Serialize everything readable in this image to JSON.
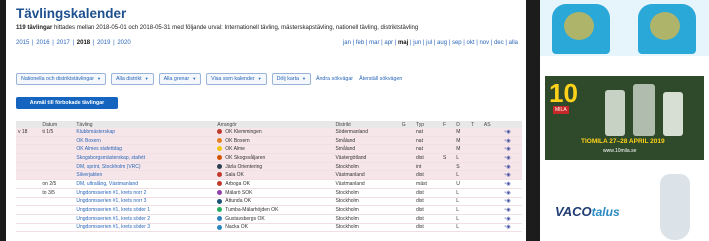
{
  "page": {
    "title": "Tävlingskalender",
    "summary_count": "119 tävlingar",
    "summary_text": " hittades mellan 2018-05-01 och 2018-05-31 med följande urval: Internationell tävling, mästerskapstävling, nationell tävling, distriktstävling",
    "years": [
      {
        "label": "2015",
        "selected": false
      },
      {
        "label": "2016",
        "selected": false
      },
      {
        "label": "2017",
        "selected": false
      },
      {
        "label": "2018",
        "selected": true
      },
      {
        "label": "2019",
        "selected": false
      },
      {
        "label": "2020",
        "selected": false
      }
    ],
    "months": [
      {
        "label": "jan",
        "selected": false
      },
      {
        "label": "feb",
        "selected": false
      },
      {
        "label": "mar",
        "selected": false
      },
      {
        "label": "apr",
        "selected": false
      },
      {
        "label": "maj",
        "selected": true
      },
      {
        "label": "jun",
        "selected": false
      },
      {
        "label": "jul",
        "selected": false
      },
      {
        "label": "aug",
        "selected": false
      },
      {
        "label": "sep",
        "selected": false
      },
      {
        "label": "okt",
        "selected": false
      },
      {
        "label": "nov",
        "selected": false
      },
      {
        "label": "dec",
        "selected": false
      },
      {
        "label": "alla",
        "selected": false
      }
    ],
    "filters": {
      "buttons": [
        "Nationella och distriktstävlingar",
        "Alla distrikt",
        "Alla grenar",
        "Visa som kalender",
        "Dölj karta"
      ],
      "links": [
        "Ändra sökvägar",
        "Återställ sökvägen"
      ]
    },
    "send_button": "Anmäl till förbokade tävlingar",
    "table": {
      "headers": [
        "",
        "Datum",
        "Tävling",
        "Arrangör",
        "Distrikt",
        "G",
        "Typ",
        "F",
        "D",
        "T",
        "AS",
        ""
      ],
      "rows": [
        {
          "week": "v 18",
          "date": "ti 1/5",
          "name": "Klubbmästerskap",
          "organizer": "OK Klemmingen",
          "org_color": "#c0392b",
          "district": "Södermanland",
          "type": "nat",
          "f": "",
          "d": "M",
          "style": "pink"
        },
        {
          "week": "",
          "date": "",
          "name": "OK Boxern",
          "organizer": "OK Boxern",
          "org_color": "#e67e22",
          "district": "Småland",
          "type": "nat",
          "f": "",
          "d": "M",
          "style": "pink"
        },
        {
          "week": "",
          "date": "",
          "name": "OK Almes stafettdag",
          "organizer": "OK Alme",
          "org_color": "#f1c40f",
          "district": "Småland",
          "type": "nat",
          "f": "",
          "d": "M",
          "style": "pink"
        },
        {
          "week": "",
          "date": "",
          "name": "Skogsborgsmästerskap, stafett",
          "organizer": "OK Skogsvåljaren",
          "org_color": "#d35400",
          "district": "Västergötland",
          "type": "dist",
          "f": "S",
          "d": "L",
          "style": "pink"
        },
        {
          "week": "",
          "date": "",
          "name": "DM, sprint, Stockholm (VRC)",
          "organizer": "Järla Orientering",
          "org_color": "#2c3e50",
          "district": "Stockholm",
          "type": "int",
          "f": "",
          "d": "S",
          "style": "pink"
        },
        {
          "week": "",
          "date": "",
          "name": "Silverjakten",
          "organizer": "Sala OK",
          "org_color": "#c0392b",
          "district": "Västmanland",
          "type": "dist",
          "f": "",
          "d": "L",
          "style": "pink"
        },
        {
          "week": "",
          "date": "on 2/5",
          "name": "DM, ultralång, Västmanland",
          "organizer": "Arboga OK",
          "org_color": "#c0392b",
          "district": "Västmanland",
          "type": "mäst",
          "f": "",
          "d": "U",
          "style": "white"
        },
        {
          "week": "",
          "date": "to 3/5",
          "name": "Ungdomsserien #1, krets norr 2",
          "organizer": "Mälarö SOK",
          "org_color": "#8e44ad",
          "district": "Stockholm",
          "type": "dist",
          "f": "",
          "d": "L",
          "style": "white"
        },
        {
          "week": "",
          "date": "",
          "name": "Ungdomsserien #1, krets norr 3",
          "organizer": "Attunda OK",
          "org_color": "#1a5276",
          "district": "Stockholm",
          "type": "dist",
          "f": "",
          "d": "L",
          "style": "white"
        },
        {
          "week": "",
          "date": "",
          "name": "Ungdomsserien #1, krets söder 1",
          "organizer": "Tumba-Mälarhöjden OK",
          "org_color": "#27ae60",
          "district": "Stockholm",
          "type": "dist",
          "f": "",
          "d": "L",
          "style": "white"
        },
        {
          "week": "",
          "date": "",
          "name": "Ungdomsserien #1, krets söder 2",
          "organizer": "Gustavsbergs OK",
          "org_color": "#2980b9",
          "district": "Stockholm",
          "type": "dist",
          "f": "",
          "d": "L",
          "style": "white"
        },
        {
          "week": "",
          "date": "",
          "name": "Ungdomsserien #1, krets söder 3",
          "organizer": "Nacka OK",
          "org_color": "#2e86c1",
          "district": "Stockholm",
          "type": "dist",
          "f": "",
          "d": "L",
          "style": "white"
        }
      ]
    }
  },
  "ads": {
    "tiomila": {
      "big_text": "10",
      "badge": "MILA",
      "date": "TIOMILA 27–28 APRIL 2019",
      "url": "www.10mila.se"
    },
    "vaco": {
      "brand": "VACO",
      "brand2": "talus"
    }
  },
  "colors": {
    "title": "#1e4f8f",
    "link": "#2a66b8",
    "send_button": "#1565c0",
    "row_pink": "#f6e6ea"
  }
}
